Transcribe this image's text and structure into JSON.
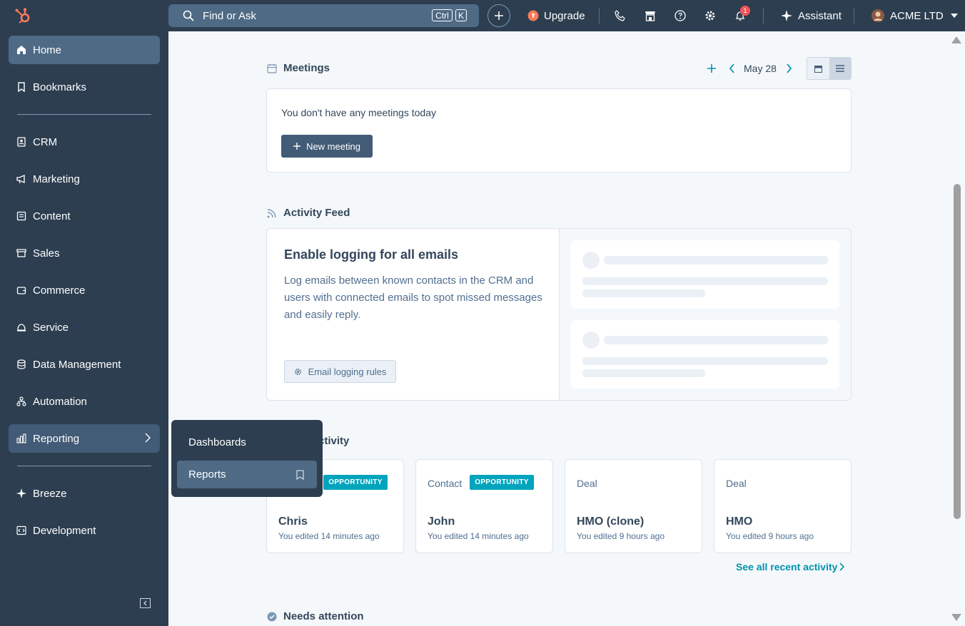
{
  "sidebar": {
    "items": [
      {
        "label": "Home",
        "icon": "home-icon"
      },
      {
        "label": "Bookmarks",
        "icon": "bookmark-icon"
      },
      {
        "label": "CRM",
        "icon": "contacts-icon"
      },
      {
        "label": "Marketing",
        "icon": "megaphone-icon"
      },
      {
        "label": "Content",
        "icon": "content-icon"
      },
      {
        "label": "Sales",
        "icon": "sales-icon"
      },
      {
        "label": "Commerce",
        "icon": "wallet-icon"
      },
      {
        "label": "Service",
        "icon": "bell-service-icon"
      },
      {
        "label": "Data Management",
        "icon": "database-icon"
      },
      {
        "label": "Automation",
        "icon": "workflow-icon"
      },
      {
        "label": "Reporting",
        "icon": "bar-chart-icon"
      },
      {
        "label": "Breeze",
        "icon": "sparkle-icon"
      },
      {
        "label": "Development",
        "icon": "code-icon"
      }
    ]
  },
  "reporting_flyout": {
    "items": [
      "Dashboards",
      "Reports"
    ]
  },
  "topbar": {
    "search_placeholder": "Find or Ask",
    "kbd_ctrl": "Ctrl",
    "kbd_k": "K",
    "upgrade": "Upgrade",
    "notification_count": "1",
    "assistant": "Assistant",
    "account": "ACME LTD"
  },
  "meetings": {
    "title": "Meetings",
    "date": "May 28",
    "empty": "You don't have any meetings today",
    "new_button": "New meeting"
  },
  "activity_feed": {
    "title": "Activity Feed",
    "heading": "Enable logging for all emails",
    "body": "Log emails between known contacts in the CRM and users with connected emails to spot missed messages and easily reply.",
    "button": "Email logging rules"
  },
  "recent": {
    "title_visible": "ctivity",
    "cards": [
      {
        "type": "",
        "tag": "OPPORTUNITY",
        "name": "Chris",
        "time": "You edited 14 minutes ago"
      },
      {
        "type": "Contact",
        "tag": "OPPORTUNITY",
        "name": "John",
        "time": "You edited 14 minutes ago"
      },
      {
        "type": "Deal",
        "tag": "",
        "name": "HMO (clone)",
        "time": "You edited 9 hours ago"
      },
      {
        "type": "Deal",
        "tag": "",
        "name": "HMO",
        "time": "You edited 9 hours ago"
      }
    ],
    "see_all": "See all recent activity"
  },
  "needs_attention": {
    "title": "Needs attention"
  },
  "colors": {
    "sidebar": "#2d3e50",
    "accent": "#00a4bd",
    "link": "#0091ae",
    "orange": "#ff7a59"
  }
}
